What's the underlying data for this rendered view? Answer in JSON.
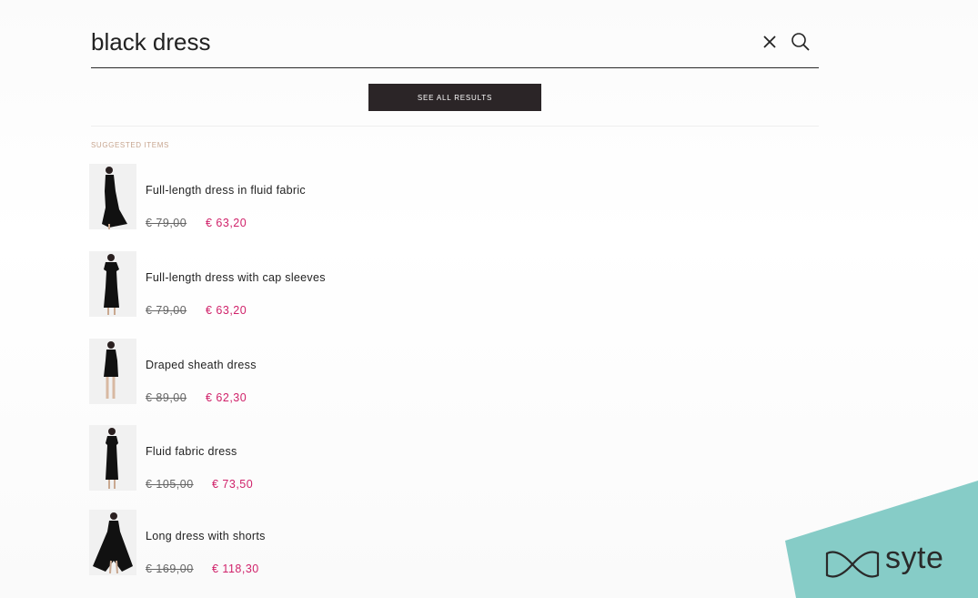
{
  "search": {
    "query": "black dress",
    "clear_icon": "close-icon",
    "search_icon": "magnifier-icon"
  },
  "see_all_label": "SEE ALL RESULTS",
  "section_label": "SUGGESTED ITEMS",
  "products": [
    {
      "name": "Full-length dress in fluid fabric",
      "old_price": "€ 79,00",
      "new_price": "€ 63,20"
    },
    {
      "name": "Full-length dress with cap sleeves",
      "old_price": "€ 79,00",
      "new_price": "€ 63,20"
    },
    {
      "name": "Draped sheath dress",
      "old_price": "€ 89,00",
      "new_price": "€ 62,30"
    },
    {
      "name": "Fluid fabric dress",
      "old_price": "€ 105,00",
      "new_price": "€ 73,50"
    },
    {
      "name": "Long dress with shorts",
      "old_price": "€ 169,00",
      "new_price": "€ 118,30"
    }
  ],
  "brand": {
    "name": "syte",
    "accent": "#86ccc7"
  },
  "colors": {
    "sale_price": "#d0226a",
    "button_bg": "#2b2527",
    "section_label": "#c7a58f"
  }
}
